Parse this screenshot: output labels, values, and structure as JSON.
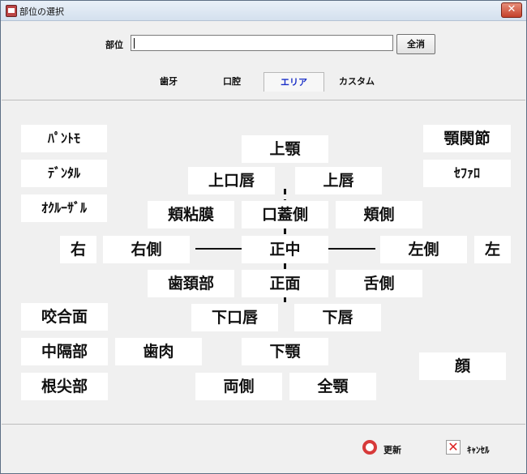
{
  "window": {
    "title": "部位の選択",
    "close_label": "✕"
  },
  "search": {
    "label": "部位",
    "value": "",
    "clear_label": "全消"
  },
  "tabs": [
    {
      "label": "歯牙",
      "active": false
    },
    {
      "label": "口腔",
      "active": false
    },
    {
      "label": "エリア",
      "active": true
    },
    {
      "label": "カスタム",
      "active": false
    }
  ],
  "areas": {
    "panto": "ﾊﾟﾝﾄﾓ",
    "dental": "ﾃﾞﾝﾀﾙ",
    "occlusal": "ｵｸﾙｰｻﾞﾙ",
    "tmj": "顎関節",
    "cephalo": "ｾﾌｧﾛ",
    "upper_jaw": "上顎",
    "upper_lip_mucosa": "上口唇",
    "upper_lip": "上唇",
    "buccal_mucosa": "頬粘膜",
    "palate_side": "口蓋側",
    "buccal_side": "頬側",
    "right": "右",
    "right_side": "右側",
    "midline": "正中",
    "left_side": "左側",
    "left": "左",
    "gingival_neck": "歯頚部",
    "front": "正面",
    "lingual_side": "舌側",
    "lower_lip_mucosa": "下口唇",
    "lower_lip": "下唇",
    "occlusal_surface": "咬合面",
    "interdental": "中隔部",
    "gingiva": "歯肉",
    "lower_jaw": "下顎",
    "apical": "根尖部",
    "both_sides": "両側",
    "full_jaw": "全顎",
    "face": "顔"
  },
  "footer": {
    "update_label": "更新",
    "cancel_label": "ｷｬﾝｾﾙ"
  },
  "colors": {
    "active_tab_text": "#1a2fc8",
    "ok_icon": "#d73a3a",
    "cancel_icon": "#d22222"
  }
}
